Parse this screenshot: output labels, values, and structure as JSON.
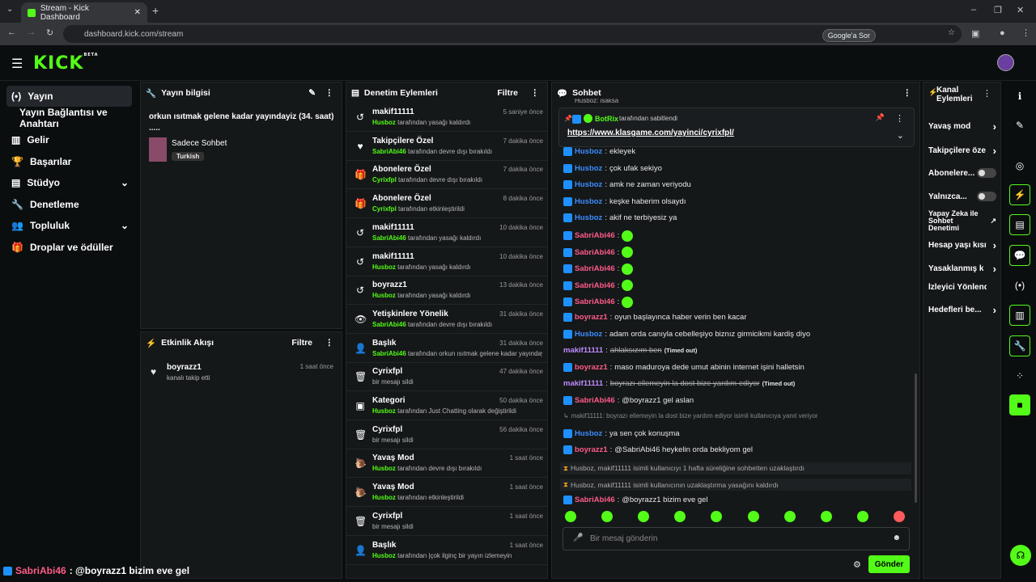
{
  "browser": {
    "tab_title": "Stream - Kick Dashboard",
    "url": "dashboard.kick.com/stream",
    "google_btn": "Google'a Sor"
  },
  "header": {
    "logo": "KICK",
    "beta": "BETA"
  },
  "sidebar": {
    "items": [
      {
        "label": "Yayın",
        "icon": "broadcast-icon"
      },
      {
        "label": "Yayın Bağlantısı ve Anahtarı",
        "icon": ""
      },
      {
        "label": "Gelir",
        "icon": "chart-icon"
      },
      {
        "label": "Başarılar",
        "icon": "trophy-icon"
      },
      {
        "label": "Stüdyo",
        "icon": "studio-icon"
      },
      {
        "label": "Denetleme",
        "icon": "wrench-icon"
      },
      {
        "label": "Topluluk",
        "icon": "users-icon"
      },
      {
        "label": "Droplar ve ödüller",
        "icon": "gift-icon"
      }
    ]
  },
  "stream_info": {
    "title": "Yayın bilgisi",
    "stream_title": "orkun ısıtmak gelene kadar yayındayiz (34. saat)",
    "ellipsis": ".....",
    "category": "Sadece Sohbet",
    "language": "Turkish"
  },
  "activity": {
    "title": "Etkinlik Akışı",
    "filter": "Filtre",
    "items": [
      {
        "user": "boyrazz1",
        "text": "kanalı takip etti",
        "time": "1 saat önce"
      }
    ]
  },
  "mod_actions": {
    "title": "Denetim Eylemleri",
    "filter": "Filtre",
    "items": [
      {
        "icon": "undo-icon",
        "title": "makif11111",
        "who": "Husboz",
        "rest": "tarafından yasağı kaldırdı",
        "time": "5 saniye önce"
      },
      {
        "icon": "heart-icon",
        "title": "Takipçilere Özel",
        "who": "SabriAbi46",
        "rest": "tarafından devre dışı bırakıldı",
        "time": "7 dakika önce"
      },
      {
        "icon": "gift-icon",
        "title": "Abonelere Özel",
        "who": "Cyrixfpl",
        "rest": "tarafından devre dışı bırakıldı",
        "time": "7 dakika önce"
      },
      {
        "icon": "gift-icon",
        "title": "Abonelere Özel",
        "who": "Cyrixfpl",
        "rest": "tarafından etkinleştirildi",
        "time": "8 dakika önce"
      },
      {
        "icon": "undo-icon",
        "title": "makif11111",
        "who": "SabriAbi46",
        "rest": "tarafından yasağı kaldırdı",
        "time": "10 dakika önce"
      },
      {
        "icon": "undo-icon",
        "title": "makif11111",
        "who": "Husboz",
        "rest": "tarafından yasağı kaldırdı",
        "time": "10 dakika önce"
      },
      {
        "icon": "undo-icon",
        "title": "boyrazz1",
        "who": "Husboz",
        "rest": "tarafından yasağı kaldırdı",
        "time": "13 dakika önce"
      },
      {
        "icon": "eye-icon",
        "title": "Yetişkinlere Yönelik",
        "who": "SabriAbi46",
        "rest": "tarafından devre dışı bırakıldı",
        "time": "31 dakika önce"
      },
      {
        "icon": "user-edit-icon",
        "title": "Başlık",
        "who": "SabriAbi46",
        "rest": "tarafından orkun ısıtmak gelene kadar yayındayiz ..... olarak değiştirildi",
        "time": "31 dakika önce"
      },
      {
        "icon": "trash-icon",
        "title": "Cyrixfpl",
        "who": "",
        "rest": "bir mesajı sildi",
        "time": "47 dakika önce"
      },
      {
        "icon": "category-icon",
        "title": "Kategori",
        "who": "Husboz",
        "rest": "tarafından Just Chatting olarak değiştirildi",
        "time": "50 dakika önce"
      },
      {
        "icon": "trash-icon",
        "title": "Cyrixfpl",
        "who": "",
        "rest": "bir mesajı sildi",
        "time": "56 dakika önce"
      },
      {
        "icon": "snail-icon",
        "title": "Yavaş Mod",
        "who": "Husboz",
        "rest": "tarafından devre dışı bırakıldı",
        "time": "1 saat önce"
      },
      {
        "icon": "snail-icon",
        "title": "Yavaş Mod",
        "who": "Husboz",
        "rest": "tarafından etkinleştirildi",
        "time": "1 saat önce"
      },
      {
        "icon": "trash-icon",
        "title": "Cyrixfpl",
        "who": "",
        "rest": "bir mesajı sildi",
        "time": "1 saat önce"
      },
      {
        "icon": "user-edit-icon",
        "title": "Başlık",
        "who": "Husboz",
        "rest": "tarafından |çok ilginç bir yayın izlemeyin",
        "time": "1 saat önce"
      }
    ]
  },
  "chat": {
    "title": "Sohbet",
    "pinned_by": "BotRix",
    "pinned_by_rest": "tarafından sabitlendi",
    "pinned_link": "https://www.klasgame.com/yayinci/cyrixfpl/",
    "top_partial": "Husboz: isaksa",
    "messages": [
      {
        "user": "Husboz",
        "color": "#3b8cff",
        "text": "ekleyek",
        "badge": true
      },
      {
        "user": "Husboz",
        "color": "#3b8cff",
        "text": "çok ufak sekiyo",
        "badge": true
      },
      {
        "user": "Husboz",
        "color": "#3b8cff",
        "text": "amk ne zaman veriyodu",
        "badge": true
      },
      {
        "user": "Husboz",
        "color": "#3b8cff",
        "text": "keşke haberim olsaydı",
        "badge": true
      },
      {
        "user": "Husboz",
        "color": "#3b8cff",
        "text": "akif ne terbiyesiz ya",
        "badge": true
      },
      {
        "user": "SabriAbi46",
        "color": "#ff5b8a",
        "text": "",
        "badge": true,
        "emote": true
      },
      {
        "user": "SabriAbi46",
        "color": "#ff5b8a",
        "text": "",
        "badge": true,
        "emote": true
      },
      {
        "user": "SabriAbi46",
        "color": "#ff5b8a",
        "text": "",
        "badge": true,
        "emote": true
      },
      {
        "user": "SabriAbi46",
        "color": "#ff5b8a",
        "text": "",
        "badge": true,
        "emote": true
      },
      {
        "user": "SabriAbi46",
        "color": "#ff5b8a",
        "text": "",
        "badge": true,
        "emote": true
      },
      {
        "user": "boyrazz1",
        "color": "#ff5b8a",
        "text": "oyun başlayınca haber verin ben kacar",
        "badge": true
      },
      {
        "user": "Husboz",
        "color": "#3b8cff",
        "text": "adam orda canıyla cebelleşiyo biznız girmicikmi kardiş diyo",
        "badge": true
      },
      {
        "user": "makif11111",
        "color": "#c08bff",
        "text": "ahlaksızım ben",
        "badge": false,
        "deleted": true,
        "tag": "(Timed out)"
      },
      {
        "user": "boyrazz1",
        "color": "#ff5b8a",
        "text": "maso maduroya dede umut abinin internet işini halletsin",
        "badge": true
      },
      {
        "user": "makif11111",
        "color": "#c08bff",
        "text": "boyrazı ellemeyin la dost bize yardım ediyor",
        "badge": false,
        "deleted": true,
        "tag": "(Timed out)"
      },
      {
        "user": "SabriAbi46",
        "color": "#ff5b8a",
        "text": "@boyrazz1 gel aslan",
        "badge": true
      },
      {
        "reply": "makif11111: boyrazı ellemeyin la dost bize yardım ediyor isimli kullanıcıya yanıt veriyor"
      },
      {
        "user": "Husboz",
        "color": "#3b8cff",
        "text": "ya sen çok konuşma",
        "badge": true
      },
      {
        "user": "boyrazz1",
        "color": "#ff5b8a",
        "text": "@SabriAbi46 heykelin orda bekliyom gel",
        "badge": true
      },
      {
        "system": "Husboz, makif11111 isimli kullanıcıyı 1 hafta süreliğine sohbetten uzaklaştırdı"
      },
      {
        "system": "Husboz, makif11111 isimli kullanıcının uzaklaştırma yasağını kaldırdı"
      },
      {
        "user": "SabriAbi46",
        "color": "#ff5b8a",
        "text": "@boyrazz1 bizim eve gel",
        "badge": true
      }
    ],
    "input_placeholder": "Bir mesaj gönderin",
    "send": "Gönder"
  },
  "channel_actions": {
    "title": "Kanal Eylemleri",
    "items": [
      {
        "label": "Yavaş mod",
        "type": "chevron"
      },
      {
        "label": "Takipçilere öze",
        "type": "chevron"
      },
      {
        "label": "Abonelere...",
        "type": "toggle"
      },
      {
        "label": "Yalnızca...",
        "type": "toggle"
      },
      {
        "label": "Yapay Zeka ile Sohbet Denetimi",
        "type": "external"
      },
      {
        "label": "Hesap yaşı kısıt",
        "type": "chevron"
      },
      {
        "label": "Yasaklanmış k",
        "type": "chevron"
      },
      {
        "label": "İzleyici Yönlendir",
        "type": "none"
      },
      {
        "label": "Hedefleri be...",
        "type": "chevron"
      }
    ]
  },
  "overlay": {
    "user": "SabriAbi46",
    "text": ": @boyrazz1 bizim eve gel"
  }
}
